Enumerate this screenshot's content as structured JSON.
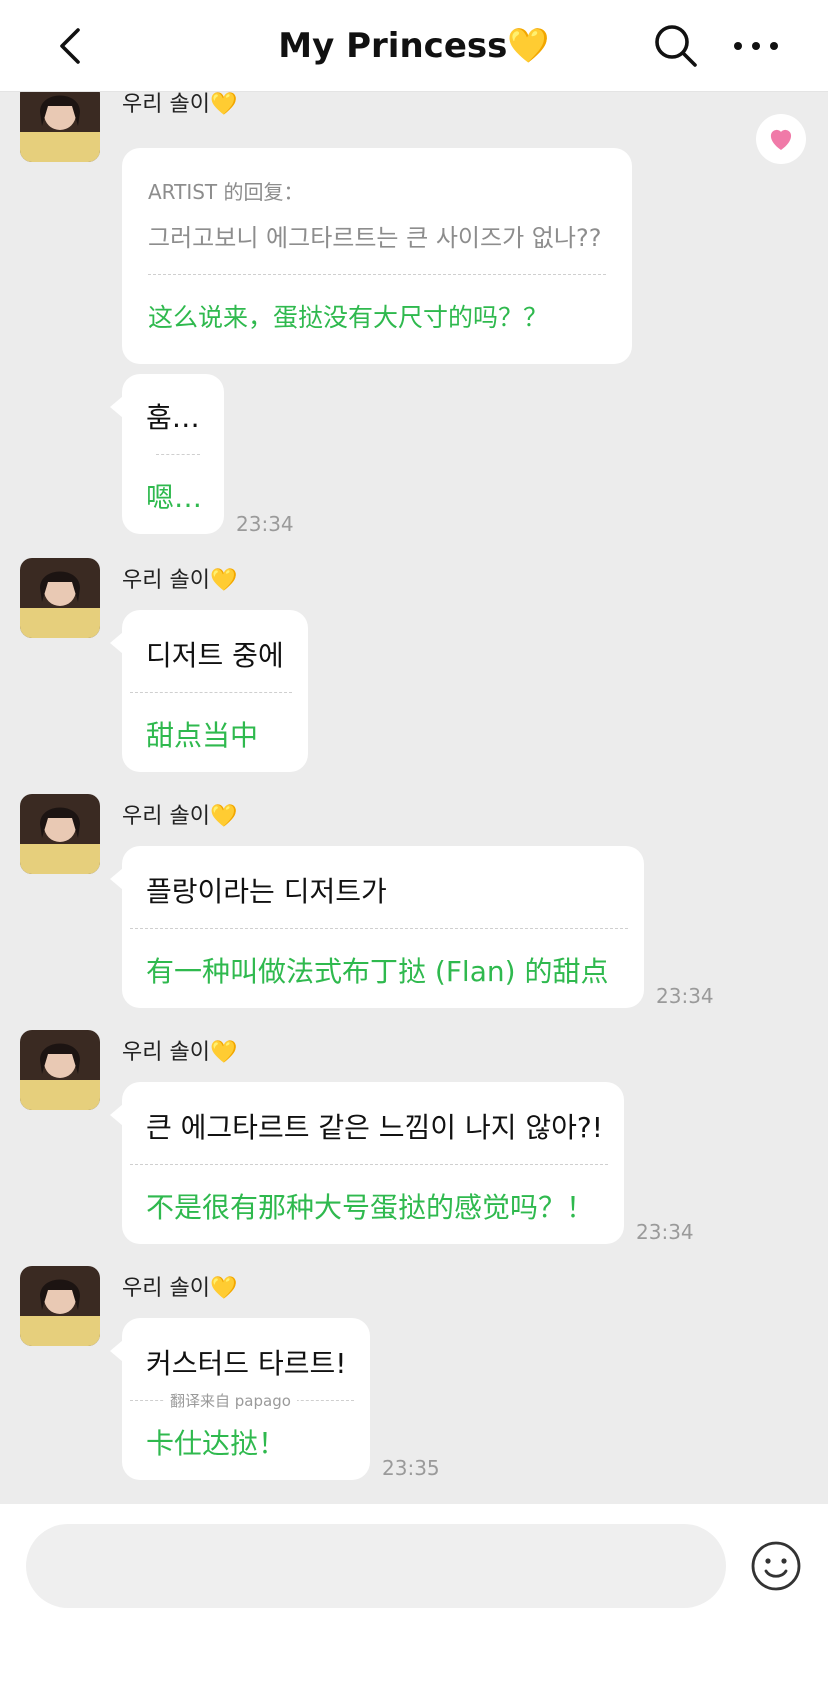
{
  "header": {
    "title": "My Princess",
    "title_emoji": "💛"
  },
  "sender_name": "우리 솔이💛",
  "top_message": {
    "sender": "우리 솔이💛",
    "reply_label": "ARTIST 的回复：",
    "reply_original": "그러고보니 에그타르트는 큰 사이즈가 없나??",
    "reply_translation": "这么说来，蛋挞没有大尺寸的吗？？"
  },
  "messages": [
    {
      "original": "훔…",
      "translation": "嗯…",
      "time": "23:34"
    },
    {
      "sender": "우리 솔이💛",
      "original": "디저트 중에",
      "translation": "甜点当中",
      "time": ""
    },
    {
      "sender": "우리 솔이💛",
      "original": "플랑이라는 디저트가",
      "translation": "有一种叫做法式布丁挞 (Flan) 的甜点",
      "time": "23:34"
    },
    {
      "sender": "우리 솔이💛",
      "original": "큰 에그타르트 같은 느낌이 나지 않아?!",
      "translation": "不是很有那种大号蛋挞的感觉吗？！",
      "time": "23:34"
    },
    {
      "sender": "우리 솔이💛",
      "original": "커스터드 타르트!",
      "translation": "卡仕达挞！",
      "time": "23:35",
      "translated_by": "翻译来自 papago"
    }
  ],
  "input": {
    "placeholder": ""
  },
  "icons": {
    "back": "chevron-left-icon",
    "search": "search-icon",
    "more": "more-dots-icon",
    "heart": "heart-icon",
    "emoji": "smiley-icon"
  },
  "colors": {
    "translation_green": "#2fb94e",
    "heart_pink": "#f07aa8",
    "background": "#ececec"
  }
}
